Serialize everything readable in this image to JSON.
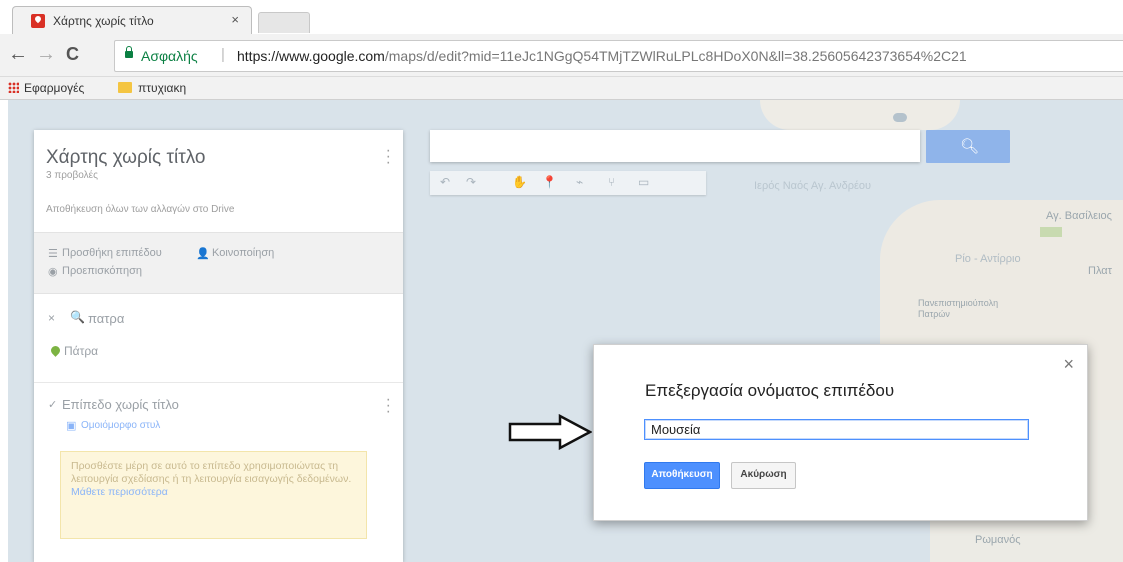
{
  "browser": {
    "tab_title": "Χάρτης χωρίς τίτλο",
    "tab_close": "×",
    "nav": {
      "back": "←",
      "forward": "→",
      "reload": "C"
    },
    "secure_label": "Ασφαλής",
    "separator": "|",
    "url_host": "https://www.google.com",
    "url_rest": "/maps/d/edit?mid=11eJc1NGgQ54TMjTZWlRuLPLc8HDoX0N&ll=38.25605642373654%2C21",
    "bookmarks": [
      {
        "label": "Εφαρμογές",
        "icon": "apps-grid-icon"
      },
      {
        "label": "πτυχιακη",
        "icon": "folder-icon"
      }
    ]
  },
  "map_labels": [
    "Ιερός Ναός Αγ. Ανδρέου",
    "Αγ. Βασίλειος",
    "Ρίο - Αντίρριο",
    "Πανεπιστημιούπολη Πατρών",
    "Ρωμανός",
    "Ρίο",
    "Πλατ"
  ],
  "panel": {
    "map_title": "Χάρτης χωρίς τίτλο",
    "views": "3 προβολές",
    "save_status": "Αποθήκευση όλων των αλλαγών στο Drive",
    "add_layer": "Προσθήκη επιπέδου",
    "share": "Κοινοποίηση",
    "preview": "Προεπισκόπηση",
    "search_result_query": "πατρα",
    "place": "Πάτρα",
    "layer_title": "Επίπεδο χωρίς τίτλο",
    "layer_style": "Ομοιόμορφο στυλ",
    "tip_text": "Προσθέστε μέρη σε αυτό το επίπεδο χρησιμοποιώντας τη λειτουργία σχεδίασης ή τη λειτουργία εισαγωγής δεδομένων.",
    "tip_link": "Μάθετε περισσότερα"
  },
  "toolbar_icons": [
    "undo-icon",
    "redo-icon",
    "hand-icon",
    "marker-icon",
    "line-icon",
    "directions-icon",
    "ruler-icon"
  ],
  "dialog": {
    "title": "Επεξεργασία ονόματος επιπέδου",
    "input_value": "Μουσεία",
    "save_label": "Αποθήκευση",
    "cancel_label": "Ακύρωση",
    "close": "×"
  },
  "colors": {
    "accent": "#4d90fe",
    "secure_green": "#0b8043",
    "map_water": "#d9e3ea",
    "tip_bg": "#fdf6dc"
  }
}
